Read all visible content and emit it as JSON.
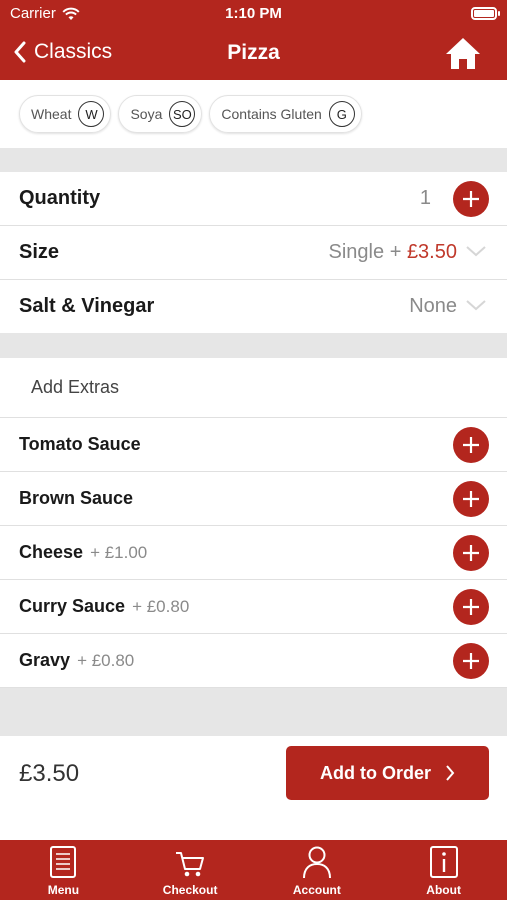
{
  "status_bar": {
    "carrier": "Carrier",
    "time": "1:10 PM"
  },
  "nav": {
    "back_label": "Classics",
    "title": "Pizza"
  },
  "allergens": [
    {
      "name": "Wheat",
      "code": "W"
    },
    {
      "name": "Soya",
      "code": "SO"
    },
    {
      "name": "Contains Gluten",
      "code": "G"
    }
  ],
  "options": {
    "quantity": {
      "label": "Quantity",
      "value": "1"
    },
    "size": {
      "label": "Size",
      "value": "Single",
      "plus": "+",
      "price": "£3.50"
    },
    "salt_vinegar": {
      "label": "Salt & Vinegar",
      "value": "None"
    }
  },
  "extras": {
    "heading": "Add Extras",
    "items": [
      {
        "label": "Tomato Sauce",
        "price": ""
      },
      {
        "label": "Brown Sauce",
        "price": ""
      },
      {
        "label": "Cheese",
        "price": "+ £1.00"
      },
      {
        "label": "Curry Sauce",
        "price": "+ £0.80"
      },
      {
        "label": "Gravy",
        "price": "+ £0.80"
      }
    ]
  },
  "footer": {
    "total": "£3.50",
    "add_label": "Add to Order"
  },
  "tabs": [
    {
      "label": "Menu",
      "icon": "menu-book-icon"
    },
    {
      "label": "Checkout",
      "icon": "cart-icon"
    },
    {
      "label": "Account",
      "icon": "person-icon"
    },
    {
      "label": "About",
      "icon": "info-icon"
    }
  ],
  "colors": {
    "brand": "#b3261e",
    "price": "#c0392b",
    "separator": "#e6e6e6"
  }
}
